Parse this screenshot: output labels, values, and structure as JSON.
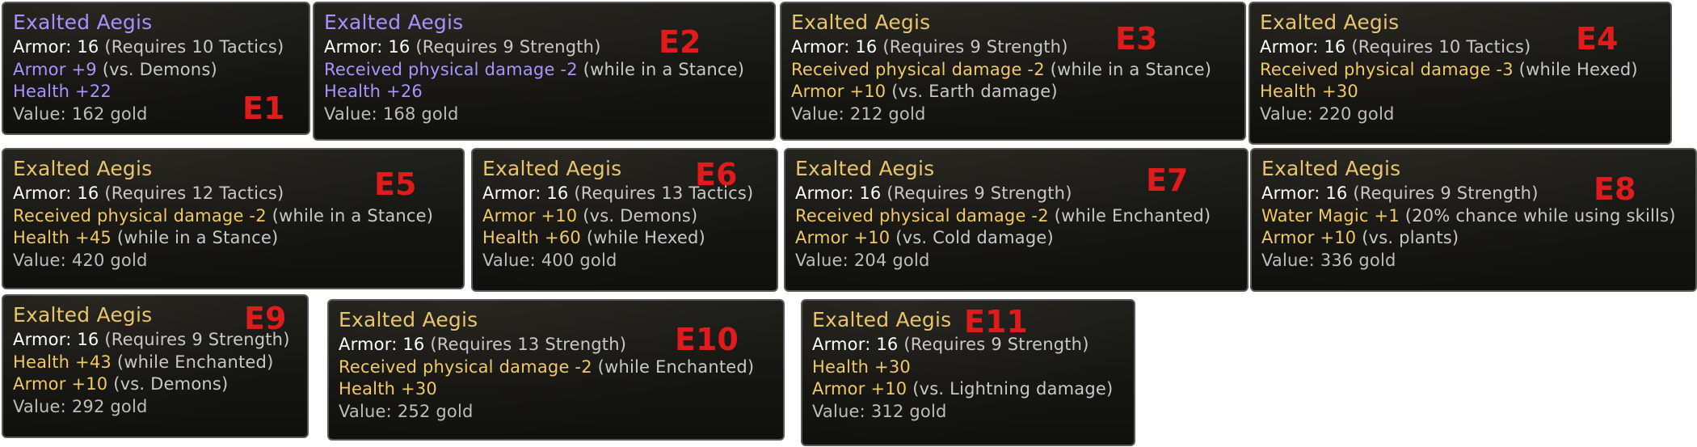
{
  "tooltips": [
    {
      "label": "E1",
      "title": "Exalted Aegis",
      "rarity": "purple",
      "armor": "Armor: 16",
      "requirement": "(Requires 10 Tactics)",
      "mods": [
        {
          "text": "Armor +9",
          "cond": "(vs. Demons)"
        },
        {
          "text": "Health +22",
          "cond": ""
        }
      ],
      "value": "Value: 162 gold"
    },
    {
      "label": "E2",
      "title": "Exalted Aegis",
      "rarity": "purple",
      "armor": "Armor: 16",
      "requirement": "(Requires 9 Strength)",
      "mods": [
        {
          "text": "Received physical damage -2",
          "cond": "(while in a Stance)"
        },
        {
          "text": "Health +26",
          "cond": ""
        }
      ],
      "value": "Value: 168 gold"
    },
    {
      "label": "E3",
      "title": "Exalted Aegis",
      "rarity": "gold",
      "armor": "Armor: 16",
      "requirement": "(Requires 9 Strength)",
      "mods": [
        {
          "text": "Received physical damage -2",
          "cond": "(while in a Stance)"
        },
        {
          "text": "Armor +10",
          "cond": "(vs. Earth damage)"
        }
      ],
      "value": "Value: 212 gold"
    },
    {
      "label": "E4",
      "title": "Exalted Aegis",
      "rarity": "gold",
      "armor": "Armor: 16",
      "requirement": "(Requires 10 Tactics)",
      "mods": [
        {
          "text": "Received physical damage -3",
          "cond": "(while Hexed)"
        },
        {
          "text": "Health +30",
          "cond": ""
        }
      ],
      "value": "Value: 220 gold"
    },
    {
      "label": "E5",
      "title": "Exalted Aegis",
      "rarity": "gold",
      "armor": "Armor: 16",
      "requirement": "(Requires 12 Tactics)",
      "mods": [
        {
          "text": "Received physical damage -2",
          "cond": "(while in a Stance)"
        },
        {
          "text": "Health +45",
          "cond": "(while in a Stance)"
        }
      ],
      "value": "Value: 420 gold"
    },
    {
      "label": "E6",
      "title": "Exalted Aegis",
      "rarity": "gold",
      "armor": "Armor: 16",
      "requirement": "(Requires 13 Tactics)",
      "mods": [
        {
          "text": "Armor +10",
          "cond": "(vs. Demons)"
        },
        {
          "text": "Health +60",
          "cond": "(while Hexed)"
        }
      ],
      "value": "Value: 400 gold"
    },
    {
      "label": "E7",
      "title": "Exalted Aegis",
      "rarity": "gold",
      "armor": "Armor: 16",
      "requirement": "(Requires 9 Strength)",
      "mods": [
        {
          "text": "Received physical damage -2",
          "cond": "(while Enchanted)"
        },
        {
          "text": "Armor +10",
          "cond": "(vs. Cold damage)"
        }
      ],
      "value": "Value: 204 gold"
    },
    {
      "label": "E8",
      "title": "Exalted Aegis",
      "rarity": "gold",
      "armor": "Armor: 16",
      "requirement": "(Requires 9 Strength)",
      "mods": [
        {
          "text": "Water Magic +1",
          "cond": "(20% chance while using skills)"
        },
        {
          "text": "Armor +10",
          "cond": "(vs. plants)"
        }
      ],
      "value": "Value: 336 gold"
    },
    {
      "label": "E9",
      "title": "Exalted Aegis",
      "rarity": "gold",
      "armor": "Armor: 16",
      "requirement": "(Requires 9 Strength)",
      "mods": [
        {
          "text": "Health +43",
          "cond": "(while Enchanted)"
        },
        {
          "text": "Armor +10",
          "cond": "(vs. Demons)"
        }
      ],
      "value": "Value: 292 gold"
    },
    {
      "label": "E10",
      "title": "Exalted Aegis",
      "rarity": "gold",
      "armor": "Armor: 16",
      "requirement": "(Requires 13 Strength)",
      "mods": [
        {
          "text": "Received physical damage -2",
          "cond": "(while Enchanted)"
        },
        {
          "text": "Health +30",
          "cond": ""
        }
      ],
      "value": "Value: 252 gold"
    },
    {
      "label": "E11",
      "title": "Exalted Aegis",
      "rarity": "gold",
      "armor": "Armor: 16",
      "requirement": "(Requires 9 Strength)",
      "mods": [
        {
          "text": "Health +30",
          "cond": ""
        },
        {
          "text": "Armor +10",
          "cond": "(vs. Lightning damage)"
        }
      ],
      "value": "Value: 312 gold"
    }
  ]
}
